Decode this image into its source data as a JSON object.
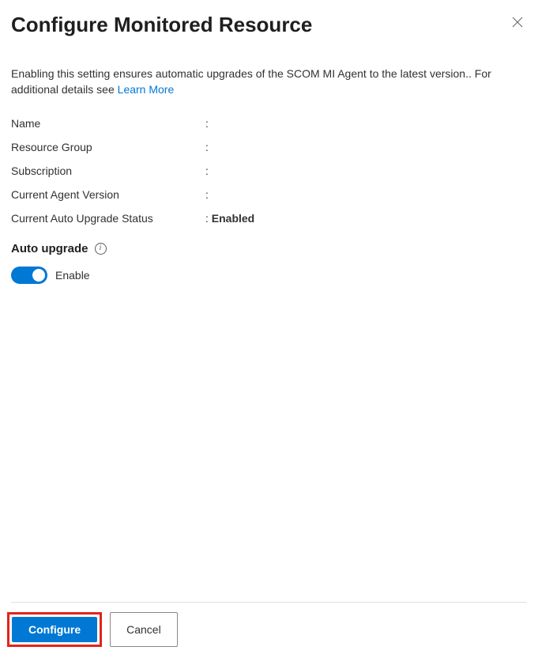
{
  "header": {
    "title": "Configure Monitored Resource"
  },
  "description": {
    "text": "Enabling this setting ensures automatic upgrades of the SCOM MI Agent to the latest version.. For additional details see ",
    "link_text": "Learn More"
  },
  "fields": {
    "name": {
      "label": "Name",
      "value": ""
    },
    "resource_group": {
      "label": "Resource Group",
      "value": ""
    },
    "subscription": {
      "label": "Subscription",
      "value": ""
    },
    "current_agent_version": {
      "label": "Current Agent Version",
      "value": ""
    },
    "current_auto_upgrade_status": {
      "label": "Current Auto Upgrade Status",
      "value": "Enabled"
    }
  },
  "auto_upgrade": {
    "section_label": "Auto upgrade",
    "toggle_label": "Enable",
    "enabled": true
  },
  "footer": {
    "configure_label": "Configure",
    "cancel_label": "Cancel"
  }
}
